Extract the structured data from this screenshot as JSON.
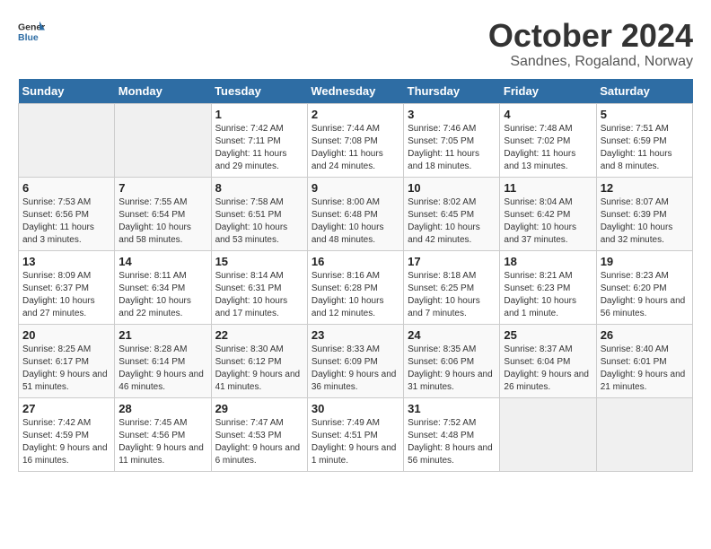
{
  "header": {
    "logo_general": "General",
    "logo_blue": "Blue",
    "main_title": "October 2024",
    "subtitle": "Sandnes, Rogaland, Norway"
  },
  "days_of_week": [
    "Sunday",
    "Monday",
    "Tuesday",
    "Wednesday",
    "Thursday",
    "Friday",
    "Saturday"
  ],
  "weeks": [
    [
      {
        "day": "",
        "info": ""
      },
      {
        "day": "",
        "info": ""
      },
      {
        "day": "1",
        "info": "Sunrise: 7:42 AM\nSunset: 7:11 PM\nDaylight: 11 hours and 29 minutes."
      },
      {
        "day": "2",
        "info": "Sunrise: 7:44 AM\nSunset: 7:08 PM\nDaylight: 11 hours and 24 minutes."
      },
      {
        "day": "3",
        "info": "Sunrise: 7:46 AM\nSunset: 7:05 PM\nDaylight: 11 hours and 18 minutes."
      },
      {
        "day": "4",
        "info": "Sunrise: 7:48 AM\nSunset: 7:02 PM\nDaylight: 11 hours and 13 minutes."
      },
      {
        "day": "5",
        "info": "Sunrise: 7:51 AM\nSunset: 6:59 PM\nDaylight: 11 hours and 8 minutes."
      }
    ],
    [
      {
        "day": "6",
        "info": "Sunrise: 7:53 AM\nSunset: 6:56 PM\nDaylight: 11 hours and 3 minutes."
      },
      {
        "day": "7",
        "info": "Sunrise: 7:55 AM\nSunset: 6:54 PM\nDaylight: 10 hours and 58 minutes."
      },
      {
        "day": "8",
        "info": "Sunrise: 7:58 AM\nSunset: 6:51 PM\nDaylight: 10 hours and 53 minutes."
      },
      {
        "day": "9",
        "info": "Sunrise: 8:00 AM\nSunset: 6:48 PM\nDaylight: 10 hours and 48 minutes."
      },
      {
        "day": "10",
        "info": "Sunrise: 8:02 AM\nSunset: 6:45 PM\nDaylight: 10 hours and 42 minutes."
      },
      {
        "day": "11",
        "info": "Sunrise: 8:04 AM\nSunset: 6:42 PM\nDaylight: 10 hours and 37 minutes."
      },
      {
        "day": "12",
        "info": "Sunrise: 8:07 AM\nSunset: 6:39 PM\nDaylight: 10 hours and 32 minutes."
      }
    ],
    [
      {
        "day": "13",
        "info": "Sunrise: 8:09 AM\nSunset: 6:37 PM\nDaylight: 10 hours and 27 minutes."
      },
      {
        "day": "14",
        "info": "Sunrise: 8:11 AM\nSunset: 6:34 PM\nDaylight: 10 hours and 22 minutes."
      },
      {
        "day": "15",
        "info": "Sunrise: 8:14 AM\nSunset: 6:31 PM\nDaylight: 10 hours and 17 minutes."
      },
      {
        "day": "16",
        "info": "Sunrise: 8:16 AM\nSunset: 6:28 PM\nDaylight: 10 hours and 12 minutes."
      },
      {
        "day": "17",
        "info": "Sunrise: 8:18 AM\nSunset: 6:25 PM\nDaylight: 10 hours and 7 minutes."
      },
      {
        "day": "18",
        "info": "Sunrise: 8:21 AM\nSunset: 6:23 PM\nDaylight: 10 hours and 1 minute."
      },
      {
        "day": "19",
        "info": "Sunrise: 8:23 AM\nSunset: 6:20 PM\nDaylight: 9 hours and 56 minutes."
      }
    ],
    [
      {
        "day": "20",
        "info": "Sunrise: 8:25 AM\nSunset: 6:17 PM\nDaylight: 9 hours and 51 minutes."
      },
      {
        "day": "21",
        "info": "Sunrise: 8:28 AM\nSunset: 6:14 PM\nDaylight: 9 hours and 46 minutes."
      },
      {
        "day": "22",
        "info": "Sunrise: 8:30 AM\nSunset: 6:12 PM\nDaylight: 9 hours and 41 minutes."
      },
      {
        "day": "23",
        "info": "Sunrise: 8:33 AM\nSunset: 6:09 PM\nDaylight: 9 hours and 36 minutes."
      },
      {
        "day": "24",
        "info": "Sunrise: 8:35 AM\nSunset: 6:06 PM\nDaylight: 9 hours and 31 minutes."
      },
      {
        "day": "25",
        "info": "Sunrise: 8:37 AM\nSunset: 6:04 PM\nDaylight: 9 hours and 26 minutes."
      },
      {
        "day": "26",
        "info": "Sunrise: 8:40 AM\nSunset: 6:01 PM\nDaylight: 9 hours and 21 minutes."
      }
    ],
    [
      {
        "day": "27",
        "info": "Sunrise: 7:42 AM\nSunset: 4:59 PM\nDaylight: 9 hours and 16 minutes."
      },
      {
        "day": "28",
        "info": "Sunrise: 7:45 AM\nSunset: 4:56 PM\nDaylight: 9 hours and 11 minutes."
      },
      {
        "day": "29",
        "info": "Sunrise: 7:47 AM\nSunset: 4:53 PM\nDaylight: 9 hours and 6 minutes."
      },
      {
        "day": "30",
        "info": "Sunrise: 7:49 AM\nSunset: 4:51 PM\nDaylight: 9 hours and 1 minute."
      },
      {
        "day": "31",
        "info": "Sunrise: 7:52 AM\nSunset: 4:48 PM\nDaylight: 8 hours and 56 minutes."
      },
      {
        "day": "",
        "info": ""
      },
      {
        "day": "",
        "info": ""
      }
    ]
  ]
}
